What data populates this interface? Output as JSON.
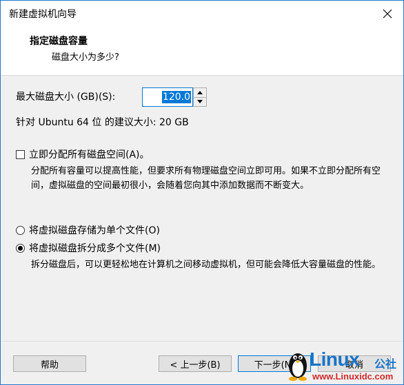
{
  "window": {
    "title": "新建虚拟机向导"
  },
  "header": {
    "title": "指定磁盘容量",
    "subtitle": "磁盘大小为多少?"
  },
  "disk": {
    "size_label": "最大磁盘大小 (GB)(S):",
    "size_value": "120.0",
    "recommendation": "针对 Ubuntu 64 位 的建议大小: 20 GB"
  },
  "allocate": {
    "label": "立即分配所有磁盘空间(A)。",
    "checked": false,
    "description": "分配所有容量可以提高性能，但要求所有物理磁盘空间立即可用。如果不立即分配所有空间，虚拟磁盘的空间最初很小，会随着您向其中添加数据而不断变大。"
  },
  "storage_options": {
    "single_file_label": "将虚拟磁盘存储为单个文件(O)",
    "split_files_label": "将虚拟磁盘拆分成多个文件(M)",
    "selected": "split",
    "split_description": "拆分磁盘后，可以更轻松地在计算机之间移动虚拟机，但可能会降低大容量磁盘的性能。"
  },
  "footer": {
    "help_label": "帮助",
    "back_label": "< 上一步(B)",
    "next_label": "下一步(N)",
    "cancel_label": "取消"
  },
  "watermark": {
    "brand": "Linux",
    "chinese": "公社",
    "url": "www.Linuxidc.com"
  },
  "colors": {
    "accent": "#0078d7",
    "watermark_blue": "#1a74c8",
    "watermark_red": "#d22a2a"
  }
}
